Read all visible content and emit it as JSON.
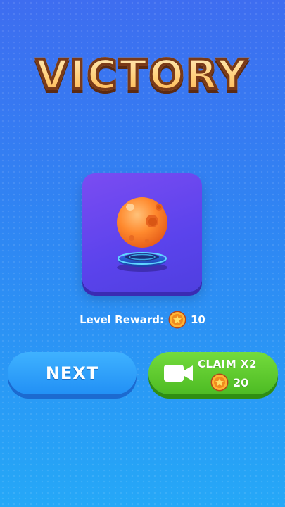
{
  "title": "VICTORY",
  "reward": {
    "label": "Level Reward:",
    "coin_icon": "coin-icon",
    "amount": "10"
  },
  "item": {
    "icon": "orange-planet-on-pedestal-icon"
  },
  "buttons": {
    "next_label": "NEXT",
    "claim_label": "CLAIM X2",
    "claim_icon": "video-camera-icon",
    "claim_amount": "20"
  },
  "colors": {
    "background_top": "#3e6df0",
    "background_bottom": "#25a8f7",
    "card": "#5b43ec",
    "next_button": "#2f9ef8",
    "claim_button": "#5cc92d",
    "title_fill": "#ffcf7a",
    "title_outline": "#7a3a18"
  }
}
